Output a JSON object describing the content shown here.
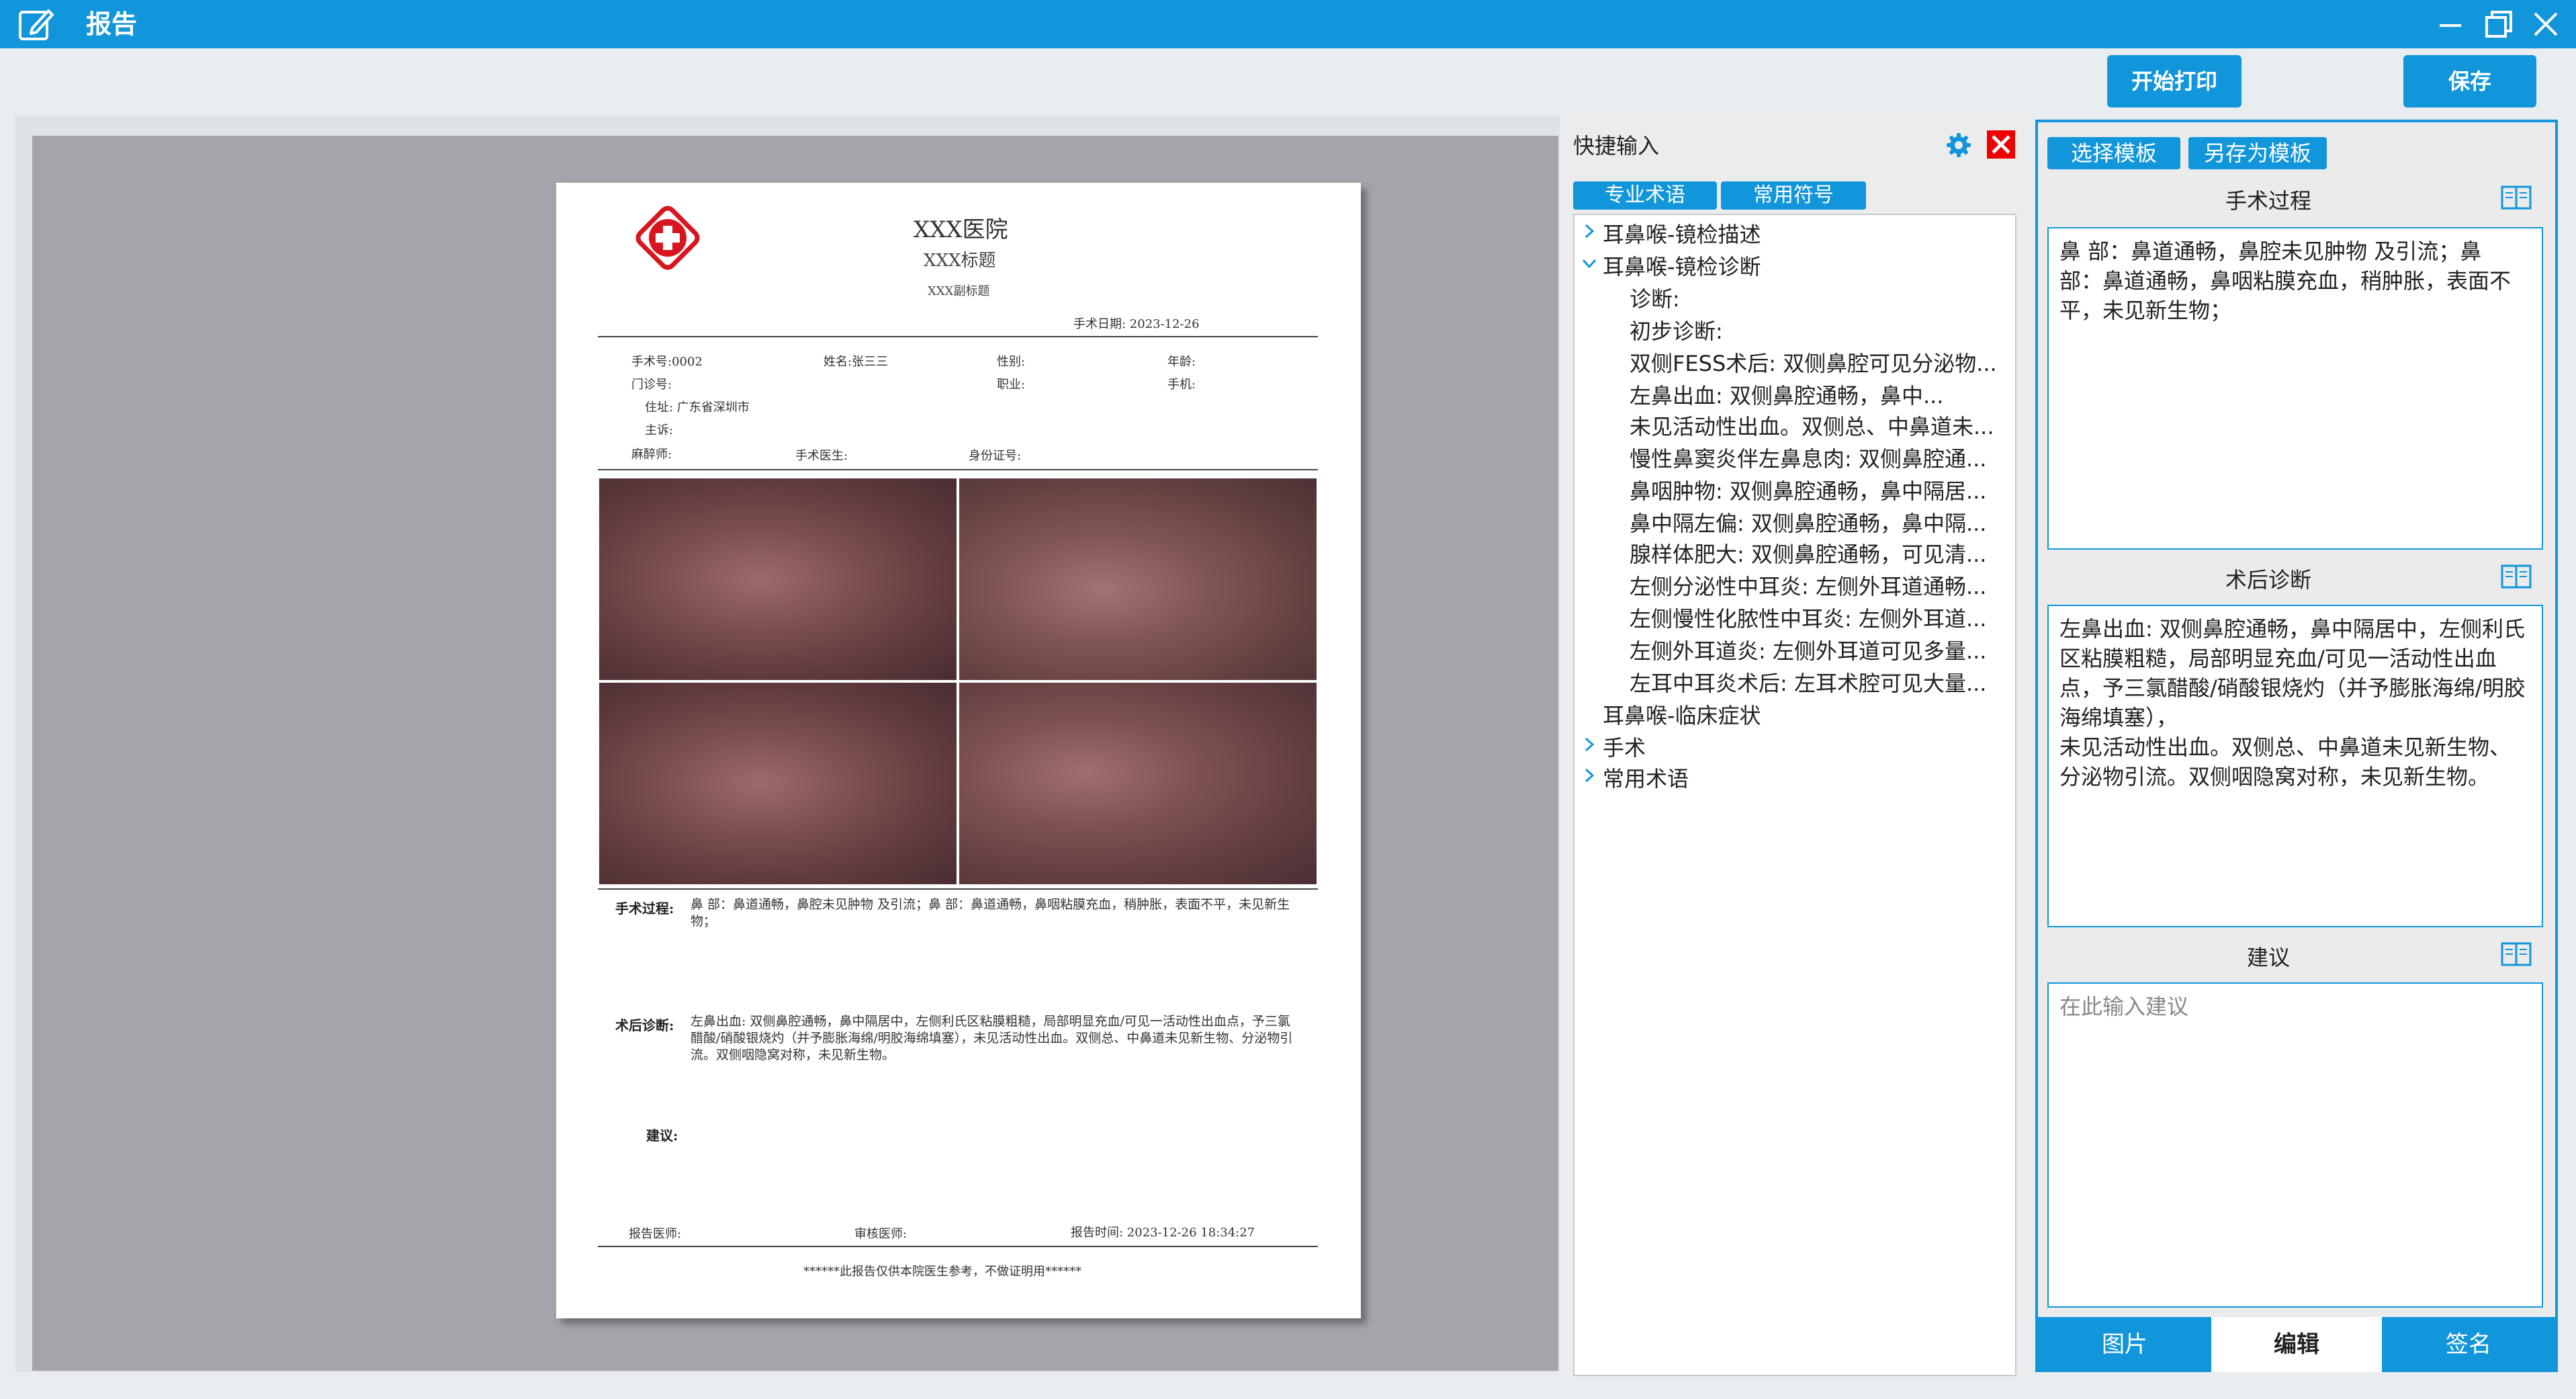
{
  "window": {
    "title": "报告"
  },
  "toolbar": {
    "print_label": "开始打印",
    "save_label": "保存"
  },
  "report": {
    "hospital": "XXX医院",
    "title": "XXX标题",
    "subtitle": "XXX副标题",
    "surgery_date": "手术日期:    2023-12-26",
    "fields": {
      "surgery_no": "手术号:0002",
      "name": "姓名:张三三",
      "gender": "性别:",
      "age": "年龄:",
      "clinic_no": "门诊号:",
      "occupation": "职业:",
      "phone": "手机:",
      "address": "住址: 广东省深圳市",
      "complaint": "主诉:",
      "anesthetist": "麻醉师:",
      "surgeon": "手术医生:",
      "id_no": "身份证号:"
    },
    "procedure_label": "手术过程:",
    "procedure_text": "鼻   部：鼻道通畅，鼻腔未见肿物 及引流；鼻   部：鼻道通畅，鼻咽粘膜充血，稍肿胀，表面不平，未见新生物；",
    "diagnosis_label": "术后诊断:",
    "diagnosis_text": "左鼻出血:            双侧鼻腔通畅，鼻中隔居中，左侧利氏区粘膜粗糙，局部明显充血/可见一活动性出血点，予三氯醋酸/硝酸银烧灼（并予膨胀海绵/明胶海绵填塞），未见活动性出血。双侧总、中鼻道未见新生物、分泌物引流。双侧咽隐窝对称，未见新生物。",
    "advice_label": "建议:",
    "report_doctor": "报告医师:",
    "review_doctor": "审核医师:",
    "report_time": "报告时间:    2023-12-26 18:34:27",
    "footer": "******此报告仅供本院医生参考，不做证明用******"
  },
  "quick_input": {
    "title": "快捷输入",
    "tabs": [
      "专业术语",
      "常用符号"
    ],
    "tree": [
      {
        "label": "耳鼻喉-镜检描述",
        "expanded": false
      },
      {
        "label": "耳鼻喉-镜检诊断",
        "expanded": true,
        "children": [
          "诊断:",
          "初步诊断:",
          "双侧FESS术后:  双侧鼻腔可见分泌物...",
          "左鼻出血:        双侧鼻腔通畅，鼻中...",
          "未见活动性出血。双侧总、中鼻道未...",
          "慢性鼻窦炎伴左鼻息肉: 双侧鼻腔通...",
          "鼻咽肿物: 双侧鼻腔通畅，鼻中隔居...",
          "鼻中隔左偏: 双侧鼻腔通畅，鼻中隔...",
          "腺样体肥大: 双侧鼻腔通畅，可见清...",
          "左侧分泌性中耳炎: 左侧外耳道通畅...",
          "左侧慢性化脓性中耳炎: 左侧外耳道...",
          "左侧外耳道炎: 左侧外耳道可见多量...",
          "左耳中耳炎术后: 左耳术腔可见大量..."
        ]
      },
      {
        "label": "耳鼻喉-临床症状",
        "expanded": false,
        "no_arrow": true
      },
      {
        "label": "手术",
        "expanded": false
      },
      {
        "label": "常用术语",
        "expanded": false
      }
    ]
  },
  "editor": {
    "template_buttons": [
      "选择模板",
      "另存为模板"
    ],
    "procedure_title": "手术过程",
    "procedure_value": "鼻  部：鼻道通畅，鼻腔未见肿物 及引流；鼻  部：鼻道通畅，鼻咽粘膜充血，稍肿胀，表面不平，未见新生物；",
    "diagnosis_title": "术后诊断",
    "diagnosis_value": "左鼻出血:         双侧鼻腔通畅，鼻中隔居中，左侧利氏区粘膜粗糙，局部明显充血/可见一活动性出血点，予三氯醋酸/硝酸银烧灼（并予膨胀海绵/明胶海绵填塞），\n未见活动性出血。双侧总、中鼻道未见新生物、分泌物引流。双侧咽隐窝对称，未见新生物。",
    "advice_title": "建议",
    "advice_placeholder": "在此输入建议",
    "bottom_tabs": [
      "图片",
      "编辑",
      "签名"
    ],
    "active_tab": "编辑"
  },
  "colors": {
    "accent": "#1296db",
    "close_red": "#ee0000",
    "logo_red": "#d7161f"
  }
}
